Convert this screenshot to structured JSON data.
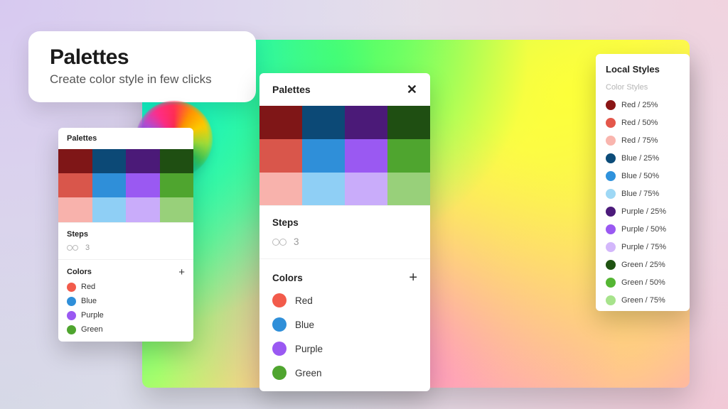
{
  "title": {
    "heading": "Palettes",
    "subtitle": "Create color style in few clicks"
  },
  "panel": {
    "title": "Palettes",
    "steps_label": "Steps",
    "steps_value": "3",
    "colors_label": "Colors",
    "colors": [
      {
        "name": "Red",
        "hex": "#F25B4B"
      },
      {
        "name": "Blue",
        "hex": "#2F8FD9"
      },
      {
        "name": "Purple",
        "hex": "#9A59F2"
      },
      {
        "name": "Green",
        "hex": "#4FA52F"
      }
    ],
    "swatch_rows": [
      [
        "#7F1617",
        "#0C4976",
        "#4B1A78",
        "#1F4F12"
      ],
      [
        "#D9564B",
        "#2F8FD9",
        "#9A59F2",
        "#4FA52F"
      ],
      [
        "#F8B2AC",
        "#8FCFF5",
        "#C9ACFA",
        "#98D07A"
      ]
    ]
  },
  "localStyles": {
    "heading": "Local Styles",
    "subheading": "Color Styles",
    "items": [
      {
        "label": "Red / 25%",
        "hex": "#8A1616"
      },
      {
        "label": "Red / 50%",
        "hex": "#E4574B"
      },
      {
        "label": "Red / 75%",
        "hex": "#F9B5AE"
      },
      {
        "label": "Blue / 25%",
        "hex": "#0C4C79"
      },
      {
        "label": "Blue / 50%",
        "hex": "#2F92DC"
      },
      {
        "label": "Blue / 75%",
        "hex": "#9ED8F5"
      },
      {
        "label": "Purple / 25%",
        "hex": "#4C1B7B"
      },
      {
        "label": "Purple / 50%",
        "hex": "#9A59F2"
      },
      {
        "label": "Purple / 75%",
        "hex": "#D3B7FB"
      },
      {
        "label": "Green / 25%",
        "hex": "#1F5312"
      },
      {
        "label": "Green / 50%",
        "hex": "#55B634"
      },
      {
        "label": "Green / 75%",
        "hex": "#A7E38C"
      }
    ]
  }
}
